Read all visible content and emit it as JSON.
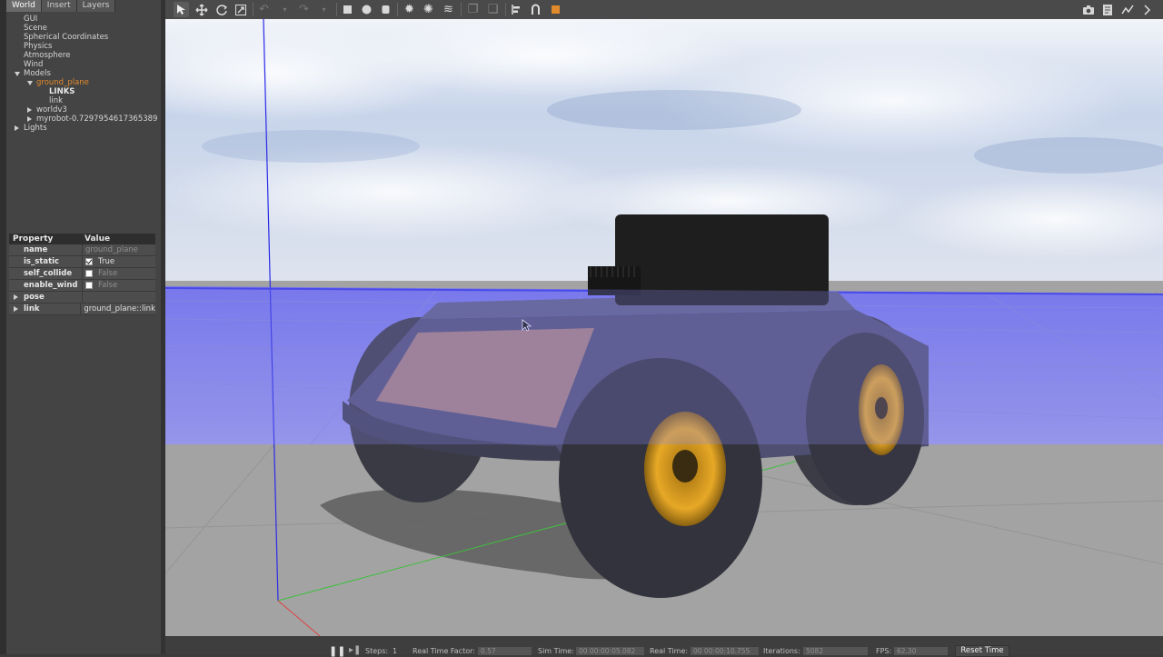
{
  "tabs": [
    "World",
    "Insert",
    "Layers"
  ],
  "tree": {
    "items": [
      {
        "label": "GUI",
        "indent": 0,
        "arrow": "none"
      },
      {
        "label": "Scene",
        "indent": 0,
        "arrow": "none"
      },
      {
        "label": "Spherical Coordinates",
        "indent": 0,
        "arrow": "none"
      },
      {
        "label": "Physics",
        "indent": 0,
        "arrow": "none"
      },
      {
        "label": "Atmosphere",
        "indent": 0,
        "arrow": "none"
      },
      {
        "label": "Wind",
        "indent": 0,
        "arrow": "none"
      },
      {
        "label": "Models",
        "indent": 0,
        "arrow": "down"
      },
      {
        "label": "ground_plane",
        "indent": 1,
        "arrow": "down",
        "selected": true
      },
      {
        "label": "LINKS",
        "indent": 2,
        "arrow": "none",
        "bold": true
      },
      {
        "label": "link",
        "indent": 2,
        "arrow": "none"
      },
      {
        "label": "worldv3",
        "indent": 1,
        "arrow": "right"
      },
      {
        "label": "myrobot-0.7297954617365389",
        "indent": 1,
        "arrow": "right"
      },
      {
        "label": "Lights",
        "indent": 0,
        "arrow": "right"
      }
    ]
  },
  "properties": {
    "header_property": "Property",
    "header_value": "Value",
    "rows": [
      {
        "name": "name",
        "value": "ground_plane",
        "checkbox": "none"
      },
      {
        "name": "is_static",
        "value": "True",
        "checkbox": "checked"
      },
      {
        "name": "self_collide",
        "value": "False",
        "checkbox": "unchecked"
      },
      {
        "name": "enable_wind",
        "value": "False",
        "checkbox": "unchecked"
      },
      {
        "name": "pose",
        "value": "",
        "checkbox": "none",
        "expandable": true
      },
      {
        "name": "link",
        "value": "ground_plane::link",
        "checkbox": "none",
        "expandable": true
      }
    ]
  },
  "toolbar": {
    "icons": [
      "select-arrow-icon",
      "translate-icon",
      "rotate-icon",
      "scale-icon",
      "undo-icon",
      "redo-icon",
      "box-icon",
      "sphere-icon",
      "cylinder-icon",
      "point-light-icon",
      "spot-light-icon",
      "directional-light-icon",
      "copy-icon",
      "paste-icon",
      "align-icon",
      "snap-icon",
      "color-icon",
      "screenshot-icon",
      "log-icon",
      "plot-icon"
    ]
  },
  "bottom_bar": {
    "steps_label": "Steps:",
    "steps_value": "1",
    "rtf_label": "Real Time Factor:",
    "rtf_value": "0.57",
    "sim_time_label": "Sim Time:",
    "sim_time_value": "00 00:00:05.082",
    "real_time_label": "Real Time:",
    "real_time_value": "00 00:00:10.755",
    "iterations_label": "Iterations:",
    "iterations_value": "5082",
    "fps_label": "FPS:",
    "fps_value": "62.30",
    "reset_label": "Reset Time"
  },
  "colors": {
    "selection": "#e08a2c",
    "panel": "#444444",
    "sky": "#9fb6dc",
    "ground": "#a0a0a0",
    "plane_overlay": "#7d7df0",
    "wheel_rim": "#d89a22"
  }
}
